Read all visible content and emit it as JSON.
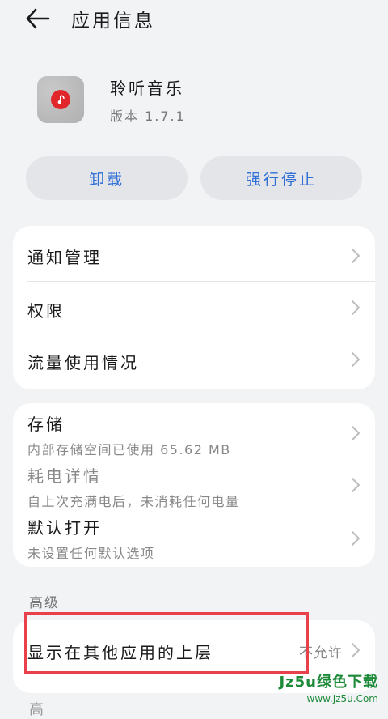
{
  "header": {
    "title": "应用信息"
  },
  "app": {
    "name": "聆听音乐",
    "version": "版本 1.7.1"
  },
  "actions": {
    "uninstall": "卸载",
    "force_stop": "强行停止"
  },
  "card1": {
    "items": [
      {
        "label": "通知管理"
      },
      {
        "label": "权限"
      },
      {
        "label": "流量使用情况"
      }
    ]
  },
  "card2": {
    "storage": {
      "label": "存储",
      "sub": "内部存储空间已使用 65.62 MB"
    },
    "battery": {
      "label": "耗电详情",
      "sub": "自上次充满电后，未消耗任何电量"
    },
    "default_open": {
      "label": "默认打开",
      "sub": "未设置任何默认选项"
    }
  },
  "advanced": {
    "section_label": "高级",
    "overlay": {
      "label": "显示在其他应用的上层",
      "value": "不允许"
    }
  },
  "watermark": {
    "title": "Jz5u绿色下载",
    "url": "www.Jz5u.Com"
  },
  "partial_next": {
    "label": "高"
  },
  "colors": {
    "accent": "#2f6fd6",
    "highlight": "#e8414b",
    "background": "#f1f3f5",
    "watermark": "#1d8a3a"
  },
  "icons": {
    "back": "back-arrow-icon",
    "chevron": "chevron-right-icon",
    "app_logo": "music-note-icon"
  }
}
